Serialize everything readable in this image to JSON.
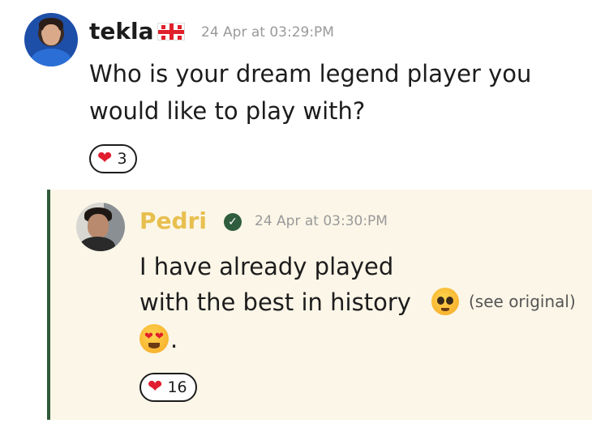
{
  "message1": {
    "author": "tekla",
    "flag": "georgia-flag-icon",
    "timestamp": "24 Apr at 03:29:PM",
    "text_line1": "Who is your dream legend player you",
    "text_line2": "would like to play with?",
    "reaction": {
      "icon": "heart-icon",
      "count": "3"
    }
  },
  "message2": {
    "author": "Pedri",
    "verified_icon": "check-circle-icon",
    "timestamp": "24 Apr at 03:30:PM",
    "text_line1": "I have already played",
    "text_line2": "with the best in history",
    "see_original": "(see original)",
    "text_line3_end": ".",
    "reaction": {
      "icon": "heart-icon",
      "count": "16"
    }
  },
  "colors": {
    "author2": "#e8bf4f",
    "quote_bg": "#fbf6e7",
    "quote_border": "#2e5a3a",
    "heart": "#e01e2e"
  }
}
